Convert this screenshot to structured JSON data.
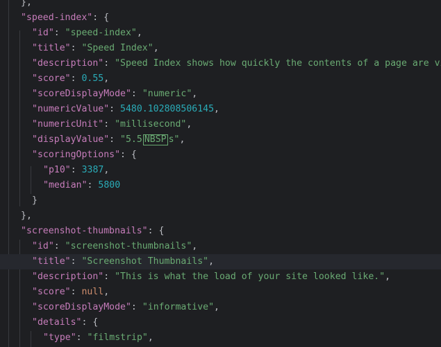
{
  "editor": {
    "current_line_index": 17,
    "lines": [
      {
        "indent": 1,
        "tokens": [
          {
            "t": "p",
            "v": "},"
          }
        ]
      },
      {
        "indent": 1,
        "tokens": [
          {
            "t": "k",
            "v": "\"speed-index\""
          },
          {
            "t": "p",
            "v": ": {"
          }
        ]
      },
      {
        "indent": 2,
        "tokens": [
          {
            "t": "k",
            "v": "\"id\""
          },
          {
            "t": "p",
            "v": ": "
          },
          {
            "t": "s",
            "v": "\"speed-index\""
          },
          {
            "t": "p",
            "v": ","
          }
        ]
      },
      {
        "indent": 2,
        "tokens": [
          {
            "t": "k",
            "v": "\"title\""
          },
          {
            "t": "p",
            "v": ": "
          },
          {
            "t": "s",
            "v": "\"Speed Index\""
          },
          {
            "t": "p",
            "v": ","
          }
        ]
      },
      {
        "indent": 2,
        "tokens": [
          {
            "t": "k",
            "v": "\"description\""
          },
          {
            "t": "p",
            "v": ": "
          },
          {
            "t": "s",
            "v": "\"Speed Index shows how quickly the contents of a page are visibly populated."
          }
        ]
      },
      {
        "indent": 2,
        "tokens": [
          {
            "t": "k",
            "v": "\"score\""
          },
          {
            "t": "p",
            "v": ": "
          },
          {
            "t": "n",
            "v": "0.55"
          },
          {
            "t": "p",
            "v": ","
          }
        ]
      },
      {
        "indent": 2,
        "tokens": [
          {
            "t": "k",
            "v": "\"scoreDisplayMode\""
          },
          {
            "t": "p",
            "v": ": "
          },
          {
            "t": "s",
            "v": "\"numeric\""
          },
          {
            "t": "p",
            "v": ","
          }
        ]
      },
      {
        "indent": 2,
        "tokens": [
          {
            "t": "k",
            "v": "\"numericValue\""
          },
          {
            "t": "p",
            "v": ": "
          },
          {
            "t": "n",
            "v": "5480.102808506145"
          },
          {
            "t": "p",
            "v": ","
          }
        ]
      },
      {
        "indent": 2,
        "tokens": [
          {
            "t": "k",
            "v": "\"numericUnit\""
          },
          {
            "t": "p",
            "v": ": "
          },
          {
            "t": "s",
            "v": "\"millisecond\""
          },
          {
            "t": "p",
            "v": ","
          }
        ]
      },
      {
        "indent": 2,
        "tokens": [
          {
            "t": "k",
            "v": "\"displayValue\""
          },
          {
            "t": "p",
            "v": ": "
          },
          {
            "t": "s",
            "v": "\"5.5"
          },
          {
            "t": "nbsp",
            "v": "NBSP"
          },
          {
            "t": "s",
            "v": "s\""
          },
          {
            "t": "p",
            "v": ","
          }
        ]
      },
      {
        "indent": 2,
        "tokens": [
          {
            "t": "k",
            "v": "\"scoringOptions\""
          },
          {
            "t": "p",
            "v": ": {"
          }
        ]
      },
      {
        "indent": 3,
        "tokens": [
          {
            "t": "k",
            "v": "\"p10\""
          },
          {
            "t": "p",
            "v": ": "
          },
          {
            "t": "n",
            "v": "3387"
          },
          {
            "t": "p",
            "v": ","
          }
        ]
      },
      {
        "indent": 3,
        "tokens": [
          {
            "t": "k",
            "v": "\"median\""
          },
          {
            "t": "p",
            "v": ": "
          },
          {
            "t": "n",
            "v": "5800"
          }
        ]
      },
      {
        "indent": 2,
        "tokens": [
          {
            "t": "p",
            "v": "}"
          }
        ]
      },
      {
        "indent": 1,
        "tokens": [
          {
            "t": "p",
            "v": "},"
          }
        ]
      },
      {
        "indent": 1,
        "tokens": [
          {
            "t": "k",
            "v": "\"screenshot-thumbnails\""
          },
          {
            "t": "p",
            "v": ": {"
          }
        ]
      },
      {
        "indent": 2,
        "tokens": [
          {
            "t": "k",
            "v": "\"id\""
          },
          {
            "t": "p",
            "v": ": "
          },
          {
            "t": "s",
            "v": "\"screenshot-thumbnails\""
          },
          {
            "t": "p",
            "v": ","
          }
        ]
      },
      {
        "indent": 2,
        "tokens": [
          {
            "t": "k",
            "v": "\"title\""
          },
          {
            "t": "p",
            "v": ": "
          },
          {
            "t": "s",
            "v": "\"Screenshot Thumbnails\""
          },
          {
            "t": "p",
            "v": ","
          }
        ]
      },
      {
        "indent": 2,
        "tokens": [
          {
            "t": "k",
            "v": "\"description\""
          },
          {
            "t": "p",
            "v": ": "
          },
          {
            "t": "s",
            "v": "\"This is what the load of your site looked like.\""
          },
          {
            "t": "p",
            "v": ","
          }
        ]
      },
      {
        "indent": 2,
        "tokens": [
          {
            "t": "k",
            "v": "\"score\""
          },
          {
            "t": "p",
            "v": ": "
          },
          {
            "t": "kw",
            "v": "null"
          },
          {
            "t": "p",
            "v": ","
          }
        ]
      },
      {
        "indent": 2,
        "tokens": [
          {
            "t": "k",
            "v": "\"scoreDisplayMode\""
          },
          {
            "t": "p",
            "v": ": "
          },
          {
            "t": "s",
            "v": "\"informative\""
          },
          {
            "t": "p",
            "v": ","
          }
        ]
      },
      {
        "indent": 2,
        "tokens": [
          {
            "t": "k",
            "v": "\"details\""
          },
          {
            "t": "p",
            "v": ": {"
          }
        ]
      },
      {
        "indent": 3,
        "tokens": [
          {
            "t": "k",
            "v": "\"type\""
          },
          {
            "t": "p",
            "v": ": "
          },
          {
            "t": "s",
            "v": "\"filmstrip\""
          },
          {
            "t": "p",
            "v": ","
          }
        ]
      }
    ]
  }
}
